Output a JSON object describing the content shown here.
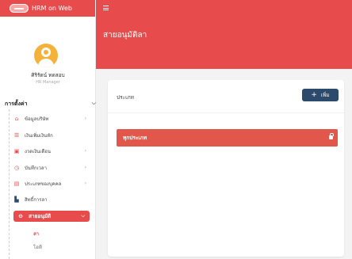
{
  "brand": {
    "app_name": "HRM on Web"
  },
  "user": {
    "name": "ศิริรัตน์ ทดสอบ",
    "role": "HR Manager"
  },
  "sidebar": {
    "section_title": "การตั้งค่า",
    "items": [
      {
        "label": "ข้อมูลบริษัท",
        "icon": "home-icon"
      },
      {
        "label": "เงินเพิ่มเงินหัก",
        "icon": "list-icon"
      },
      {
        "label": "งวดเงินเดือน",
        "icon": "money-icon"
      },
      {
        "label": "บันทึกเวลา",
        "icon": "clock-icon"
      },
      {
        "label": "ประเภทของบุคคล",
        "icon": "card-icon"
      },
      {
        "label": "สิทธิ์การลา",
        "icon": "document-icon"
      }
    ],
    "active_item": {
      "label": "สายอนุมัติ",
      "icon": "minus-circle-icon"
    },
    "sub_items": [
      {
        "label": "ลา",
        "active": true
      },
      {
        "label": "โอที",
        "active": false
      }
    ]
  },
  "page": {
    "title": "สายอนุมัติลา"
  },
  "card": {
    "type_label": "ประเภท",
    "add_label": "เพิ่ม",
    "rows": [
      {
        "label": "ทุกประเภท"
      }
    ]
  },
  "colors": {
    "accent": "#e84b4b",
    "navy_button": "#2c4a6b",
    "row_bar": "#e2574b"
  }
}
